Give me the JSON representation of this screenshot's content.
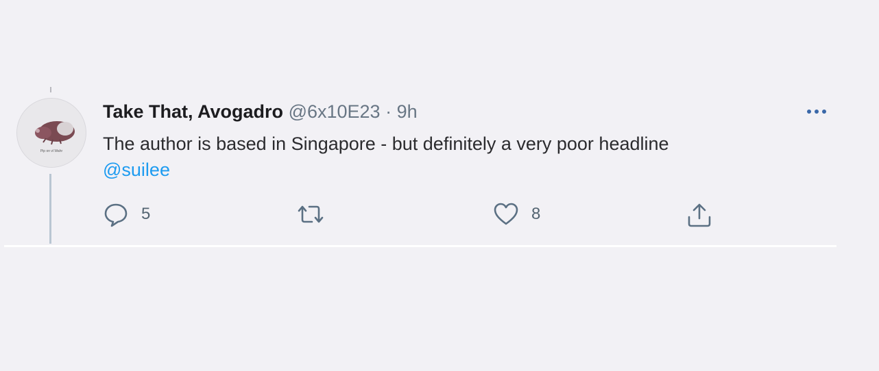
{
  "tweet": {
    "author_name": "Take That, Avogadro",
    "handle": "@6x10E23",
    "separator": "·",
    "time": "9h",
    "text": "The author is based in Singapore - but definitely a very poor headline",
    "mention": "@suilee",
    "avatar_caption": "Pip on vl Wahr",
    "actions": {
      "reply_count": "5",
      "retweet_count": "",
      "like_count": "8"
    }
  },
  "colors": {
    "background": "#f2f1f5",
    "link": "#1d9bf0",
    "secondary_text": "#687684",
    "icon": "#5b7083"
  },
  "icons": {
    "more": "more-icon",
    "reply": "reply-icon",
    "retweet": "retweet-icon",
    "like": "heart-icon",
    "share": "share-icon"
  }
}
